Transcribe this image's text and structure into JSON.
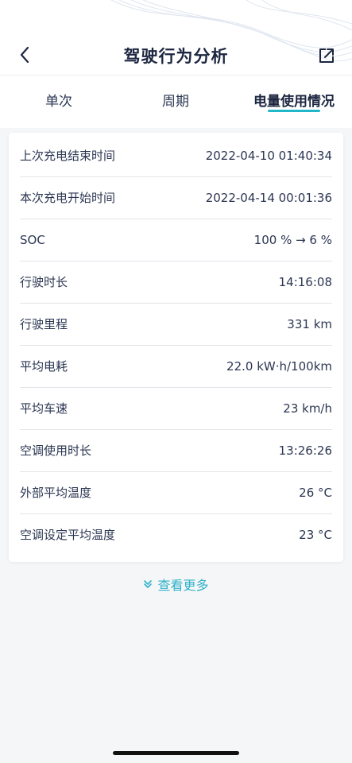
{
  "header": {
    "title": "驾驶行为分析",
    "icons": {
      "back": "chevron-left-icon",
      "share": "share-external-icon"
    }
  },
  "tabs": [
    {
      "label": "单次",
      "active": false
    },
    {
      "label": "周期",
      "active": false
    },
    {
      "label": "电量使用情况",
      "active": true
    }
  ],
  "details": [
    {
      "label": "上次充电结束时间",
      "value": "2022-04-10 01:40:34"
    },
    {
      "label": "本次充电开始时间",
      "value": "2022-04-14 00:01:36"
    },
    {
      "label": "SOC",
      "value": "100 % → 6 %"
    },
    {
      "label": "行驶时长",
      "value": "14:16:08"
    },
    {
      "label": "行驶里程",
      "value": "331 km"
    },
    {
      "label": "平均电耗",
      "value": "22.0 kW·h/100km"
    },
    {
      "label": "平均车速",
      "value": "23 km/h"
    },
    {
      "label": "空调使用时长",
      "value": "13:26:26"
    },
    {
      "label": "外部平均温度",
      "value": "26 °C"
    },
    {
      "label": "空调设定平均温度",
      "value": "23 °C"
    }
  ],
  "more": {
    "label": "查看更多",
    "icon": "double-chevron-down-icon"
  },
  "colors": {
    "accent": "#21b6c8",
    "text": "#1c2640",
    "background": "#f5f6f8"
  }
}
